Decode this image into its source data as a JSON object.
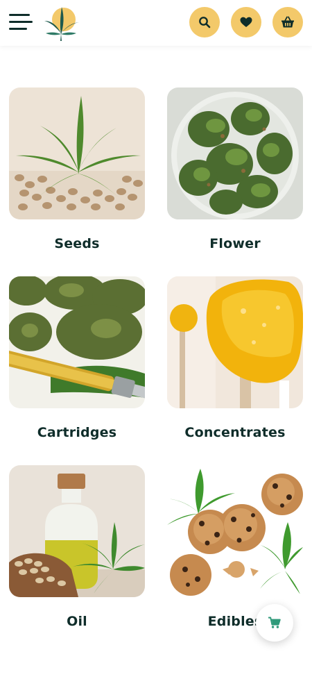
{
  "theme": {
    "accent": "#f3c96a",
    "text": "#0f2d2a",
    "fab_icon": "#2f9a7a"
  },
  "header": {
    "menu_icon": "hamburger-menu-icon",
    "logo": "cannabis-leaf-logo",
    "buttons": [
      {
        "icon": "search-icon"
      },
      {
        "icon": "heart-icon"
      },
      {
        "icon": "basket-icon"
      }
    ]
  },
  "categories": [
    {
      "label": "Seeds",
      "image": "seeds-image"
    },
    {
      "label": "Flower",
      "image": "flower-image"
    },
    {
      "label": "Cartridges",
      "image": "cartridges-image"
    },
    {
      "label": "Concentrates",
      "image": "concentrates-image"
    },
    {
      "label": "Oil",
      "image": "oil-image"
    },
    {
      "label": "Edibles",
      "image": "edibles-image"
    }
  ],
  "fab": {
    "icon": "cart-icon"
  }
}
